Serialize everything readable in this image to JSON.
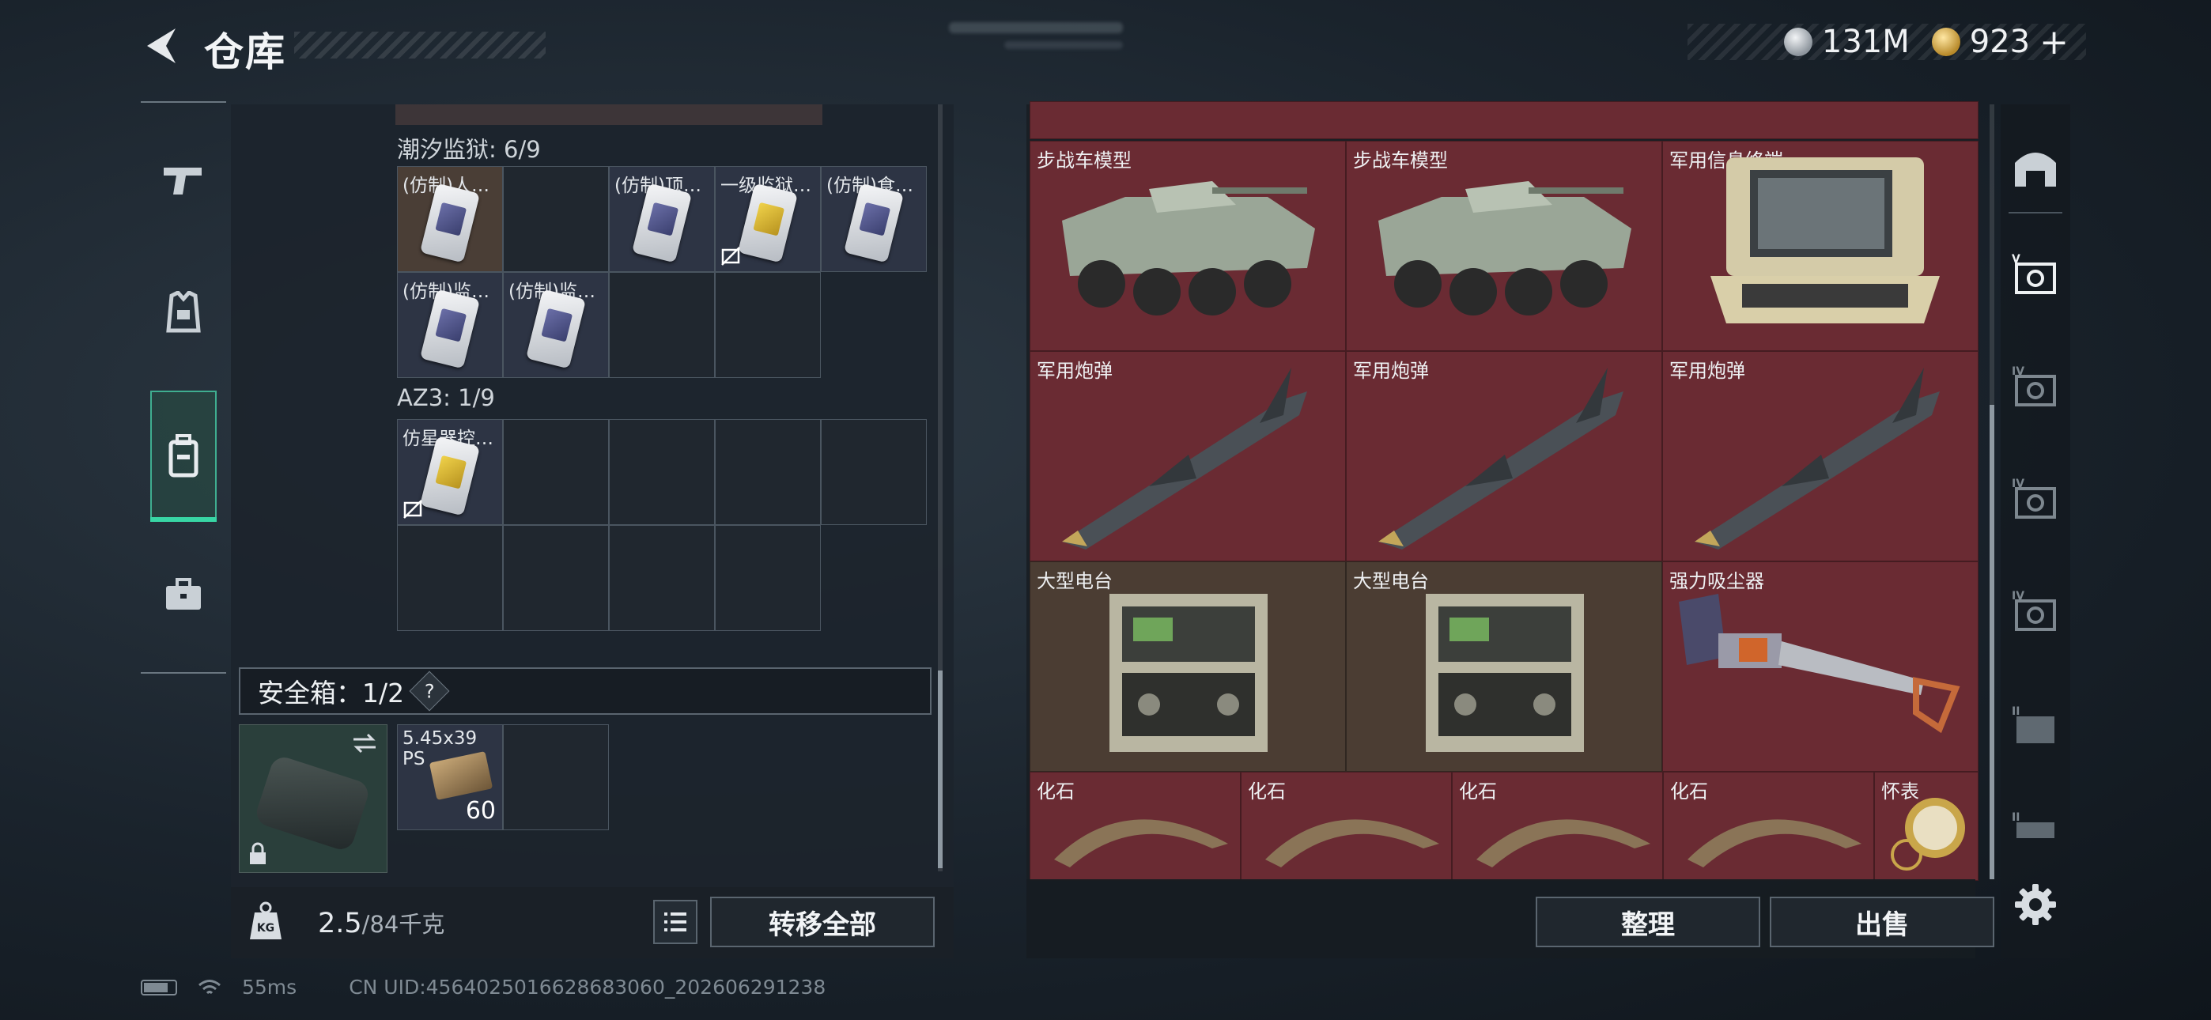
{
  "header": {
    "title": "仓库",
    "currency": [
      {
        "icon": "silver-coin-icon",
        "value": "131M"
      },
      {
        "icon": "gold-coin-icon",
        "value": "923"
      }
    ],
    "add_symbol": "+"
  },
  "left_nav": [
    {
      "icon": "pistol-icon",
      "active": false
    },
    {
      "icon": "armor-vest-icon",
      "active": false
    },
    {
      "icon": "backpack-icon",
      "active": true
    },
    {
      "icon": "toolbox-icon",
      "active": false
    }
  ],
  "stash_groups": [
    {
      "label": "潮汐监狱: 6/9",
      "cells": [
        "(仿制)人…",
        "",
        "(仿制)顶…",
        "一级监狱…",
        "(仿制)食…",
        "(仿制)监…",
        "(仿制)监…",
        "",
        ""
      ]
    },
    {
      "label": "AZ3: 1/9",
      "cells": [
        "仿星器控…",
        "",
        "",
        "",
        "",
        "",
        "",
        "",
        ""
      ]
    }
  ],
  "safe_box": {
    "label": "安全箱：1/2",
    "help": "?",
    "ammo_name_line1": "5.45x39",
    "ammo_name_line2": "PS",
    "ammo_qty": "60"
  },
  "footer_left": {
    "weight_value": "2.5",
    "weight_max": "/84千克",
    "transfer_all": "转移全部"
  },
  "right_items": [
    {
      "name": "步战车模型",
      "art": "vehicle",
      "bg": "red"
    },
    {
      "name": "步战车模型",
      "art": "vehicle",
      "bg": "red"
    },
    {
      "name": "军用信息终端",
      "art": "terminal",
      "bg": "red"
    },
    {
      "name": "军用炮弹",
      "art": "missile",
      "bg": "red"
    },
    {
      "name": "军用炮弹",
      "art": "missile",
      "bg": "red"
    },
    {
      "name": "军用炮弹",
      "art": "missile",
      "bg": "red"
    },
    {
      "name": "大型电台",
      "art": "radio",
      "bg": "brown"
    },
    {
      "name": "大型电台",
      "art": "radio",
      "bg": "brown"
    },
    {
      "name": "强力吸尘器",
      "art": "vacuum",
      "bg": "red"
    },
    {
      "name": "化石",
      "art": "fossil",
      "bg": "red"
    },
    {
      "name": "化石",
      "art": "fossil",
      "bg": "red"
    },
    {
      "name": "化石",
      "art": "fossil",
      "bg": "red"
    },
    {
      "name": "化石",
      "art": "fossil",
      "bg": "red"
    },
    {
      "name": "怀表",
      "art": "watch",
      "bg": "red"
    }
  ],
  "footer_right": {
    "sort": "整理",
    "sell": "出售"
  },
  "right_nav": [
    {
      "icon": "stash-home-icon",
      "tier": ""
    },
    {
      "icon": "tier-v-stash-icon",
      "tier": "V"
    },
    {
      "icon": "tier-iv-stash-icon",
      "tier": "IV"
    },
    {
      "icon": "tier-iv-stash-icon",
      "tier": "IV"
    },
    {
      "icon": "tier-iv-stash-icon",
      "tier": "IV"
    },
    {
      "icon": "tier-ii-stash-icon",
      "tier": "II"
    },
    {
      "icon": "tier-ii-stash-icon",
      "tier": "II"
    },
    {
      "icon": "settings-gear-icon",
      "tier": ""
    }
  ],
  "status": {
    "ping": "55ms",
    "uid": "CN UID:4564025016628683060_202606291238"
  },
  "colors": {
    "accent": "#38d6a5",
    "item_red": "#6a2b33",
    "item_brown": "#4b3d33",
    "item_blue": "#2d3444"
  }
}
